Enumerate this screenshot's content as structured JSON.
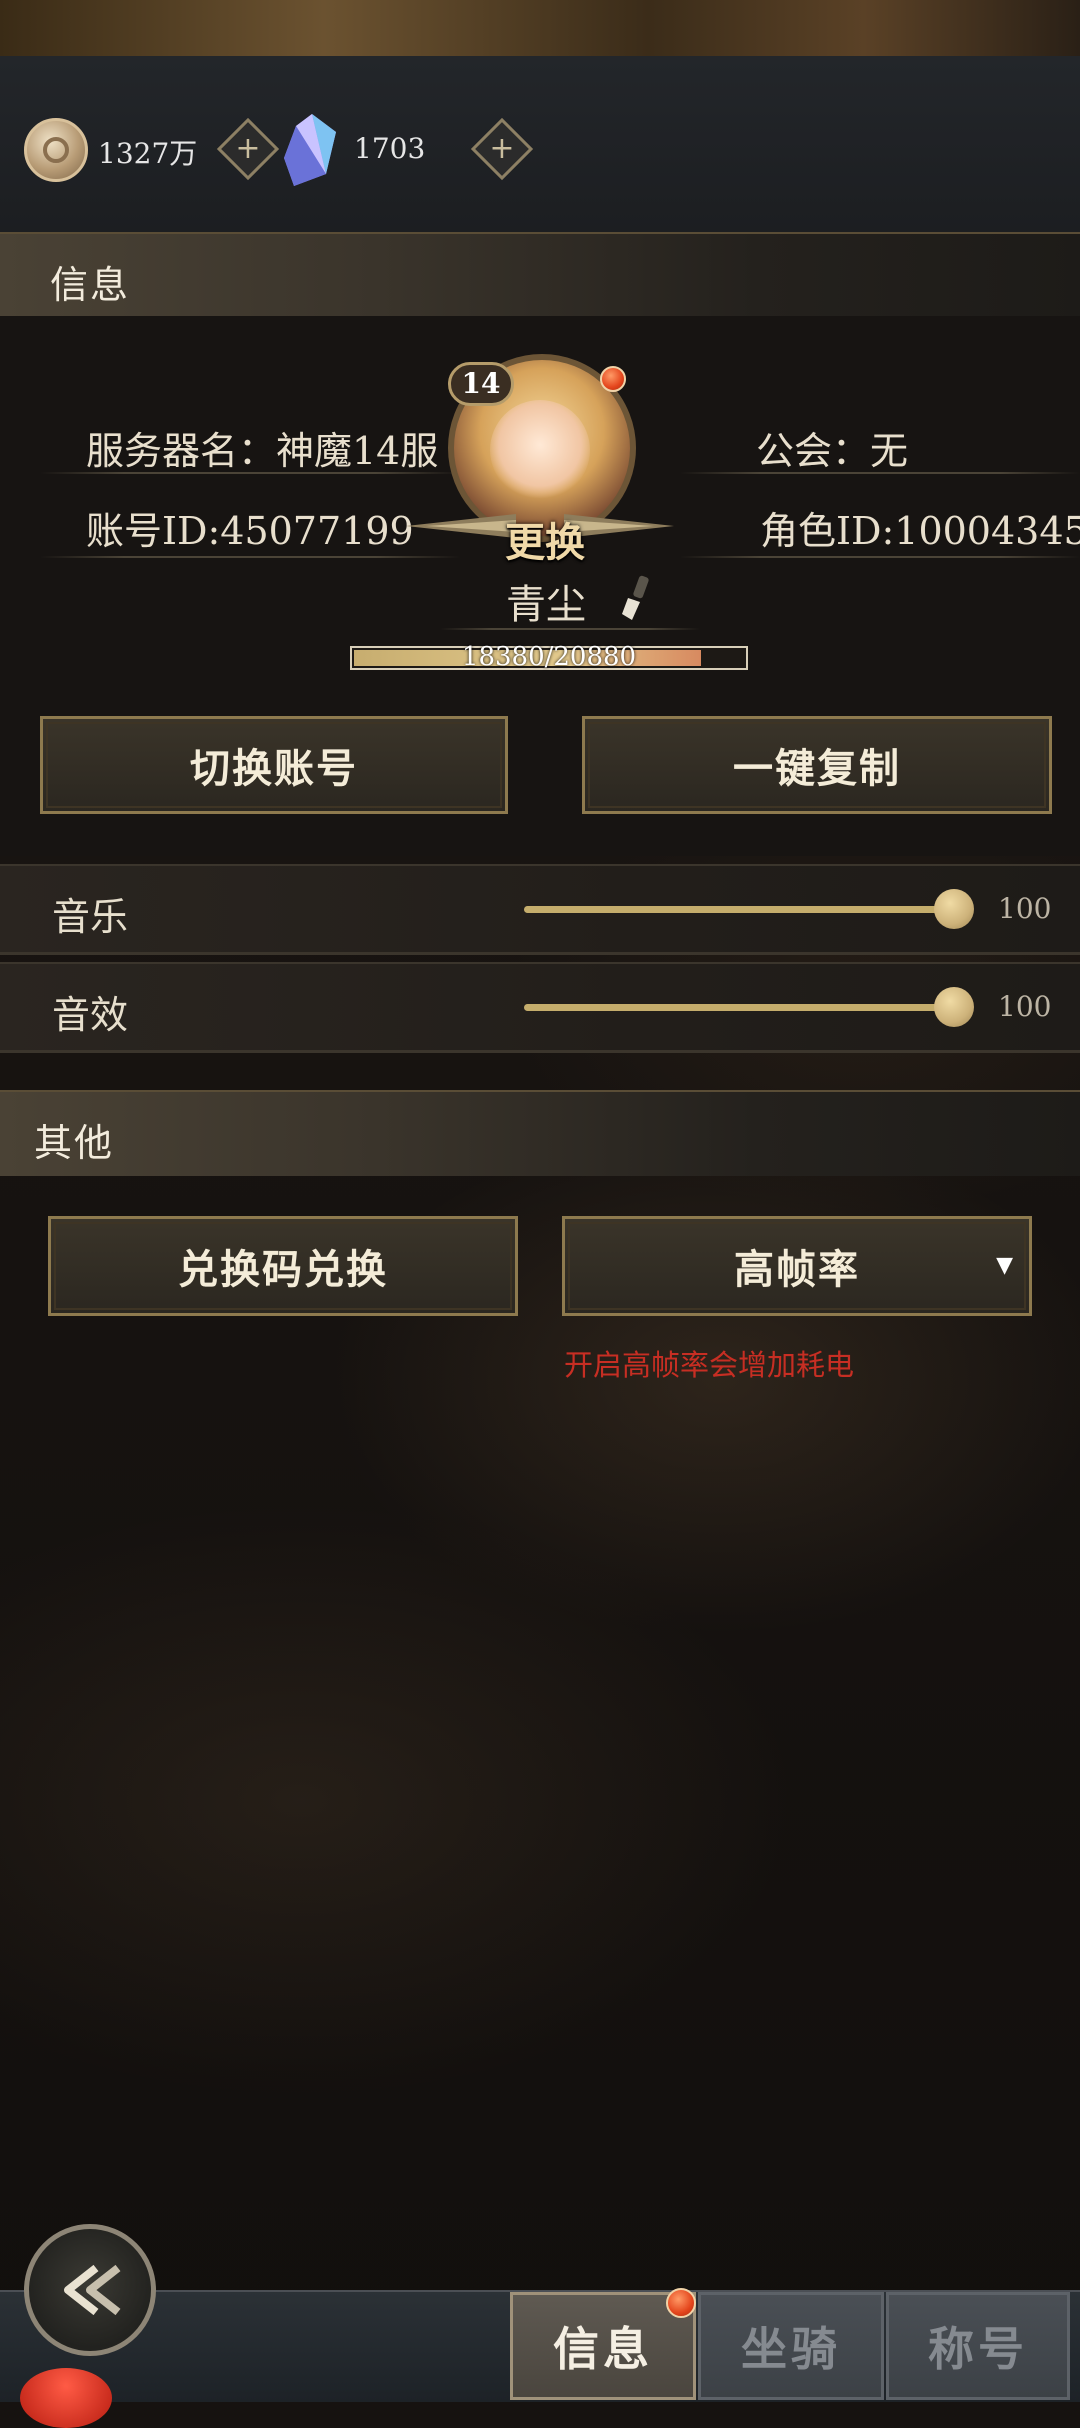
{
  "currencies": {
    "coins": "1327万",
    "crystals": "1703"
  },
  "info_section": {
    "title": "信息",
    "server_name": "服务器名：神魔14服",
    "guild": "公会：无",
    "account_id": "账号ID:45077199",
    "role_id": "角色ID:10004345",
    "level": "14",
    "change_label": "更换",
    "player_name": "青尘",
    "hp_text": "18380/20880",
    "hp_current": 18380,
    "hp_max": 20880,
    "switch_account_button": "切换账号",
    "copy_button": "一键复制"
  },
  "audio": {
    "music_label": "音乐",
    "music_value": "100",
    "sound_label": "音效",
    "sound_value": "100"
  },
  "other_section": {
    "title": "其他",
    "redeem_button": "兑换码兑换",
    "frame_rate_select": "高帧率",
    "frame_rate_hint": "开启高帧率会增加耗电"
  },
  "bottom_tabs": [
    {
      "label": "信息",
      "active": true
    },
    {
      "label": "坐骑",
      "active": false
    },
    {
      "label": "称号",
      "active": false
    }
  ],
  "colors": {
    "accent_gold": "#c5ad6c",
    "warning_red": "#c72e23",
    "notification_dot": "#e4451c"
  },
  "icons": [
    "coin-icon",
    "plus-icon",
    "crystal-icon",
    "edit-brush-icon",
    "back-arrow-icon",
    "dropdown-arrow-icon"
  ]
}
